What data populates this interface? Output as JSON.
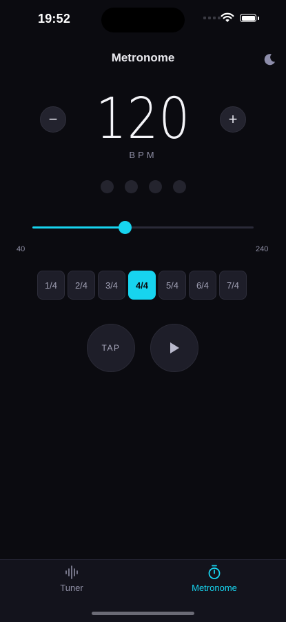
{
  "status_bar": {
    "time": "19:52"
  },
  "header": {
    "title": "Metronome"
  },
  "tempo": {
    "bpm": "120",
    "unit": "BPM",
    "decrement": "−",
    "increment": "+"
  },
  "beats": {
    "count": 4
  },
  "slider": {
    "min_label": "40",
    "max_label": "240",
    "min": 40,
    "max": 240,
    "value": 120
  },
  "time_signatures": {
    "options": [
      "1/4",
      "2/4",
      "3/4",
      "4/4",
      "5/4",
      "6/4",
      "7/4"
    ],
    "selected": "4/4"
  },
  "controls": {
    "tap_label": "TAP"
  },
  "tab_bar": {
    "tabs": [
      {
        "label": "Tuner",
        "icon": "waveform-icon",
        "active": false
      },
      {
        "label": "Metronome",
        "icon": "stopwatch-icon",
        "active": true
      }
    ]
  },
  "colors": {
    "accent": "#17d4ef",
    "background": "#0b0b10",
    "inactive": "#8e8ea4"
  }
}
